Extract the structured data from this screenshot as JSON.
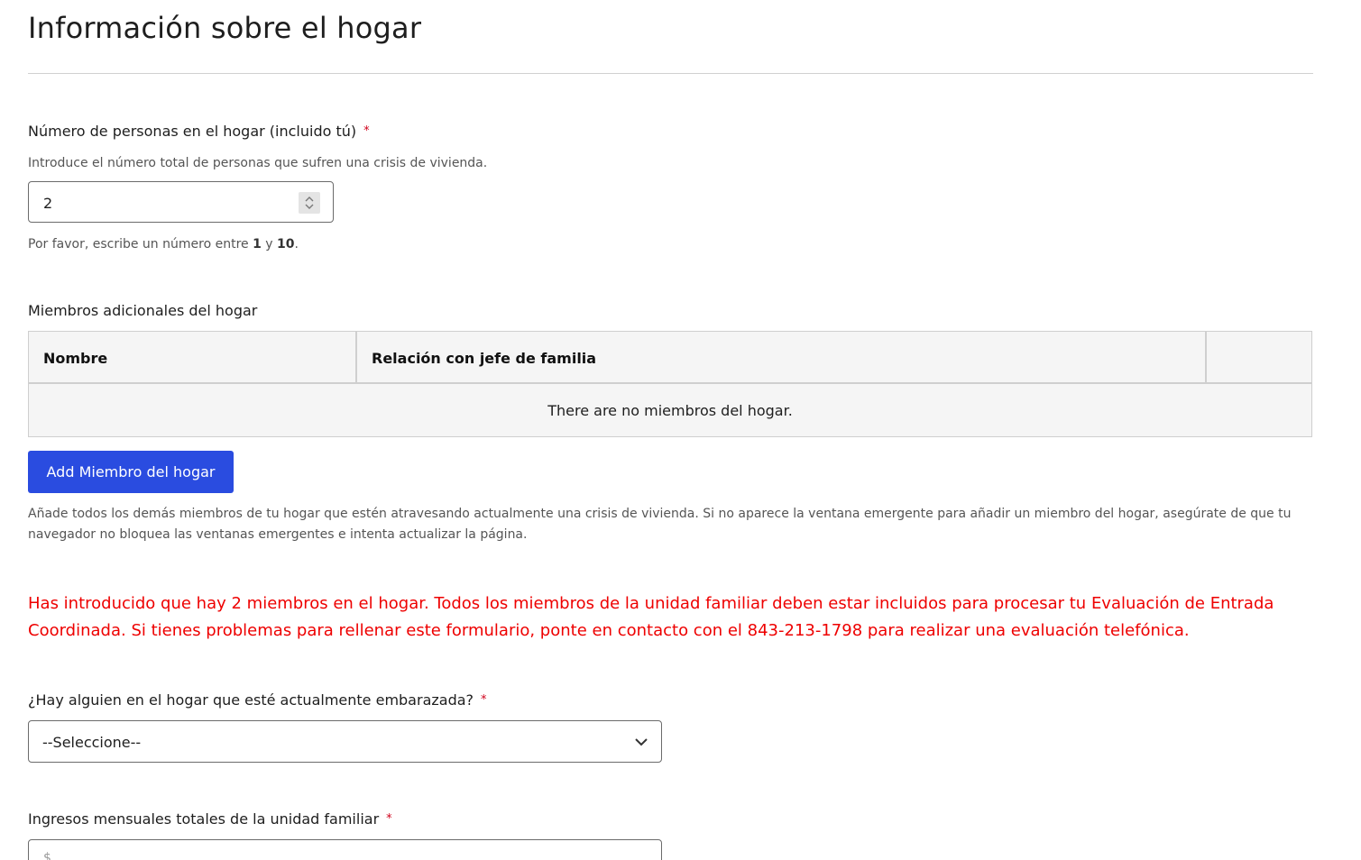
{
  "header": {
    "title": "Información sobre el hogar"
  },
  "household_size": {
    "label": "Número de personas en el hogar (incluido tú)",
    "required_mark": "*",
    "help": "Introduce el número total de personas que sufren una crisis de vivienda.",
    "value": "2",
    "range_prefix": "Por favor, escribe un número entre",
    "range_min": "1",
    "range_sep": "y",
    "range_max": "10",
    "range_suffix": "."
  },
  "members": {
    "label": "Miembros adicionales del hogar",
    "columns": [
      "Nombre",
      "Relación con jefe de familia",
      ""
    ],
    "empty_message": "There are no miembros del hogar.",
    "add_button": "Add Miembro del hogar",
    "help": "Añade todos los demás miembros de tu hogar que estén atravesando actualmente una crisis de vivienda. Si no aparece la ventana emergente para añadir un miembro del hogar, asegúrate de que tu navegador no bloquea las ventanas emergentes e intenta actualizar la página."
  },
  "warning": {
    "text": "Has introducido que hay 2 miembros en el hogar. Todos los miembros de la unidad familiar deben estar incluidos para procesar tu Evaluación de Entrada Coordinada. Si tienes problemas para rellenar este formulario, ponte en contacto con el 843-213-1798 para realizar una evaluación telefónica.",
    "color": "#ee0000"
  },
  "pregnant": {
    "label": "¿Hay alguien en el hogar que esté actualmente embarazada?",
    "required_mark": "*",
    "selected": "--Seleccione--"
  },
  "income": {
    "label": "Ingresos mensuales totales de la unidad familiar",
    "required_mark": "*",
    "prefix": "$"
  },
  "colors": {
    "accent": "#2a4ce0",
    "required": "#d0021b"
  }
}
